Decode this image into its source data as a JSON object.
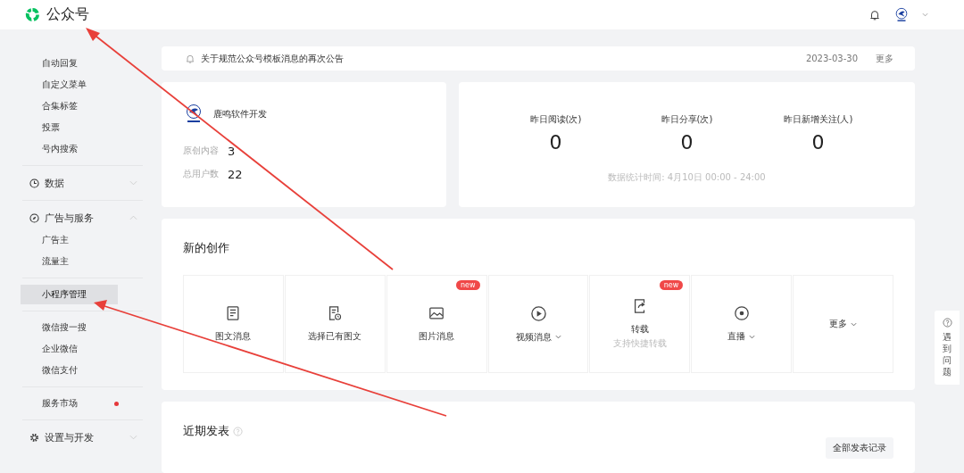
{
  "header": {
    "title": "公众号"
  },
  "sidebar": {
    "groups": [
      {
        "items": [
          {
            "kind": "link",
            "label": "自动回复",
            "selected": false,
            "dot": false
          },
          {
            "kind": "link",
            "label": "自定义菜单",
            "selected": false,
            "dot": false
          },
          {
            "kind": "link",
            "label": "合集标签",
            "selected": false,
            "dot": false
          },
          {
            "kind": "link",
            "label": "投票",
            "selected": false,
            "dot": false
          },
          {
            "kind": "link",
            "label": "号内搜索",
            "selected": false,
            "dot": false
          }
        ]
      },
      {
        "items": [
          {
            "kind": "section",
            "label": "数据",
            "expanded": false
          }
        ]
      },
      {
        "items": [
          {
            "kind": "section",
            "label": "广告与服务",
            "expanded": true
          },
          {
            "kind": "link",
            "label": "广告主",
            "selected": false,
            "dot": false
          },
          {
            "kind": "link",
            "label": "流量主",
            "selected": false,
            "dot": false
          }
        ]
      },
      {
        "items": [
          {
            "kind": "link",
            "label": "小程序管理",
            "selected": true,
            "dot": false
          }
        ]
      },
      {
        "items": [
          {
            "kind": "link",
            "label": "微信搜一搜",
            "selected": false,
            "dot": false
          },
          {
            "kind": "link",
            "label": "企业微信",
            "selected": false,
            "dot": false
          },
          {
            "kind": "link",
            "label": "微信支付",
            "selected": false,
            "dot": false
          }
        ]
      },
      {
        "items": [
          {
            "kind": "link",
            "label": "服务市场",
            "selected": false,
            "dot": true
          }
        ]
      },
      {
        "items": [
          {
            "kind": "section",
            "label": "设置与开发",
            "expanded": false
          }
        ]
      }
    ]
  },
  "notice": {
    "text": "关于规范公众号模板消息的再次公告",
    "date": "2023-03-30",
    "more": "更多"
  },
  "account": {
    "name": "鹿鸣软件开发",
    "stats": [
      {
        "label": "原创内容",
        "value": "3"
      },
      {
        "label": "总用户数",
        "value": "22"
      }
    ]
  },
  "metrics": {
    "items": [
      {
        "label": "昨日阅读(次)",
        "value": "0"
      },
      {
        "label": "昨日分享(次)",
        "value": "0"
      },
      {
        "label": "昨日新增关注(人)",
        "value": "0"
      }
    ],
    "note": "数据统计时间: 4月10日 00:00 - 24:00"
  },
  "creation": {
    "title": "新的创作",
    "tiles": [
      {
        "kind": "article",
        "label": "图文消息",
        "dropdown": false
      },
      {
        "kind": "existing",
        "label": "选择已有图文",
        "dropdown": false
      },
      {
        "kind": "image",
        "label": "图片消息",
        "dropdown": false,
        "badge": "new"
      },
      {
        "kind": "video",
        "label": "视频消息",
        "dropdown": true
      },
      {
        "kind": "repost",
        "label": "转载",
        "sublabel": "支持快捷转载",
        "dropdown": false,
        "badge": "new"
      },
      {
        "kind": "live",
        "label": "直播",
        "dropdown": true
      },
      {
        "kind": "more",
        "label": "更多",
        "dropdown": true
      }
    ]
  },
  "recent": {
    "title": "近期发表",
    "button": "全部发表记录"
  },
  "help": {
    "label": "遇到问题"
  }
}
